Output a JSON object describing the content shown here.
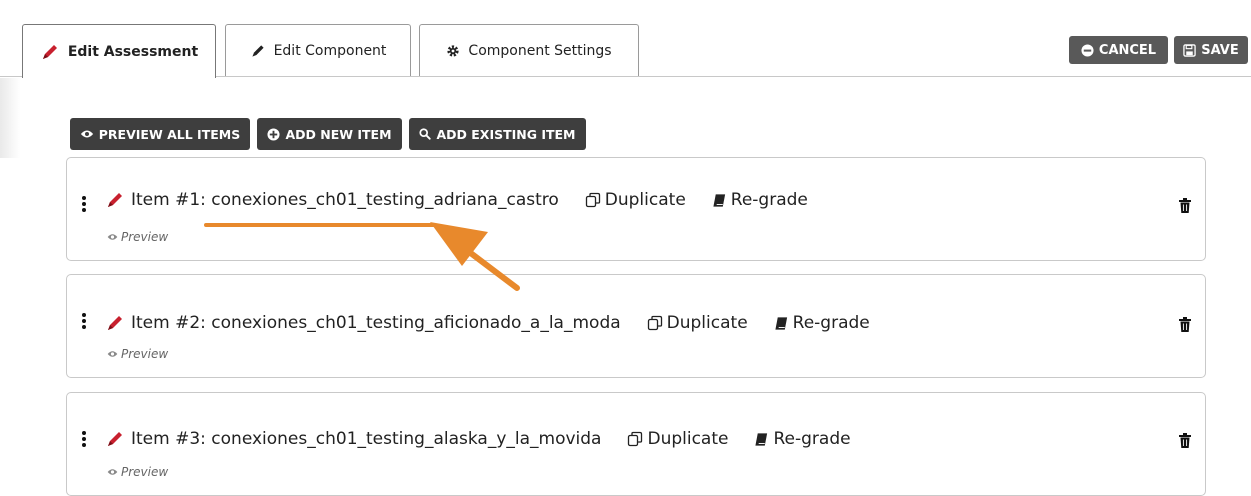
{
  "tabs": [
    {
      "label": "Edit Assessment",
      "icon": "pencil-icon",
      "active": true
    },
    {
      "label": "Edit Component",
      "icon": "pencil-icon",
      "active": false
    },
    {
      "label": "Component Settings",
      "icon": "gear-icon",
      "active": false
    }
  ],
  "header_actions": {
    "cancel": "CANCEL",
    "save": "SAVE"
  },
  "toolbar": {
    "preview_all": "PREVIEW ALL ITEMS",
    "add_new": "ADD NEW ITEM",
    "add_existing": "ADD EXISTING ITEM"
  },
  "items": [
    {
      "title": "Item #1: conexiones_ch01_testing_adriana_castro",
      "duplicate": "Duplicate",
      "regrade": "Re-grade",
      "preview": "Preview"
    },
    {
      "title": "Item #2: conexiones_ch01_testing_aficionado_a_la_moda",
      "duplicate": "Duplicate",
      "regrade": "Re-grade",
      "preview": "Preview"
    },
    {
      "title": "Item #3: conexiones_ch01_testing_alaska_y_la_movida",
      "duplicate": "Duplicate",
      "regrade": "Re-grade",
      "preview": "Preview"
    }
  ],
  "annotation": {
    "color": "#e8892c"
  },
  "colors": {
    "pencil": "#c8202e",
    "dark_button": "#3e3e3e",
    "top_button": "#595959"
  }
}
